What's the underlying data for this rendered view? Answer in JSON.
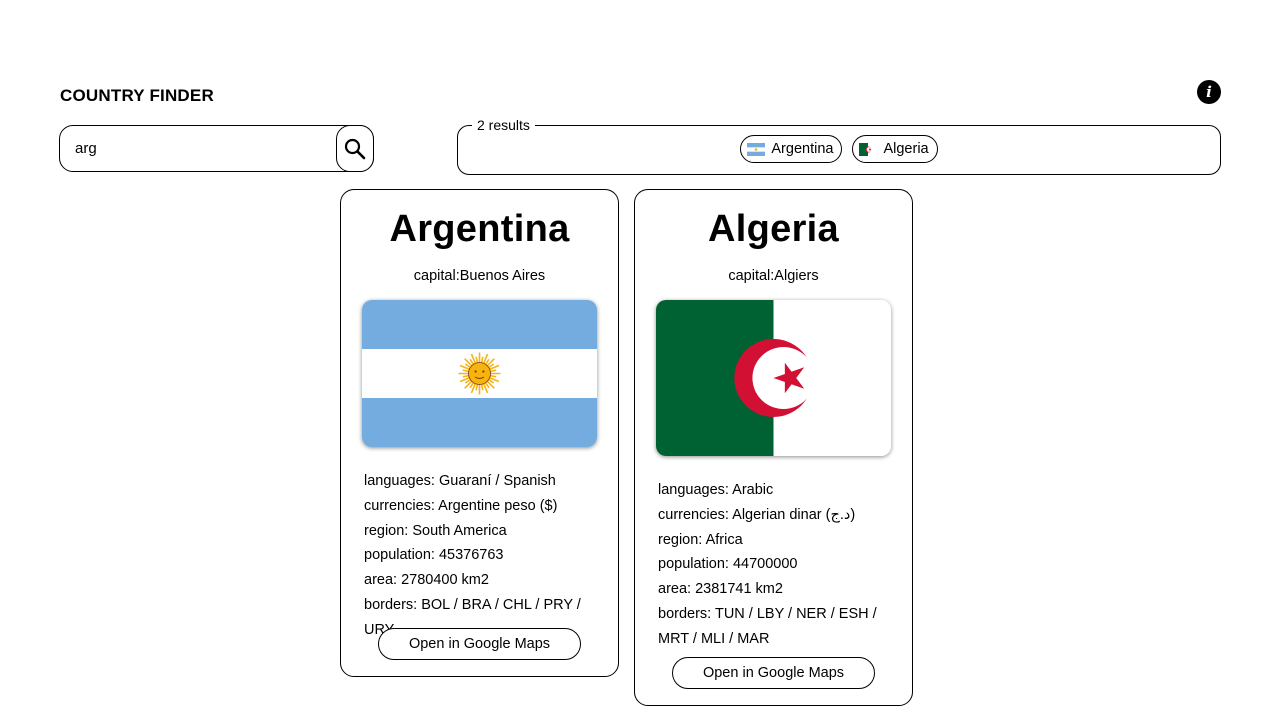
{
  "app": {
    "title": "COUNTRY FINDER",
    "info_icon": "info-icon"
  },
  "search": {
    "value": "arg",
    "placeholder": "",
    "icon": "search-icon"
  },
  "results": {
    "legend": "2 results",
    "chips": [
      {
        "label": "Argentina",
        "flag_icon": "argentina-flag-icon"
      },
      {
        "label": "Algeria",
        "flag_icon": "algeria-flag-icon"
      }
    ]
  },
  "cards": [
    {
      "name": "Argentina",
      "capital": "capital:Buenos Aires",
      "flag_icon": "argentina-flag-icon",
      "languages": "languages: Guaraní / Spanish",
      "currencies": "currencies: Argentine peso ($)",
      "region": "region: South America",
      "population": "population: 45376763",
      "area": "area: 2780400 km2",
      "borders": "borders: BOL / BRA / CHL / PRY / URY",
      "maps_label": "Open in Google Maps"
    },
    {
      "name": "Algeria",
      "capital": "capital:Algiers",
      "flag_icon": "algeria-flag-icon",
      "languages": "languages: Arabic",
      "currencies": "currencies: Algerian dinar (د.ج)",
      "region": "region: Africa",
      "population": "population: 44700000",
      "area": "area: 2381741 km2",
      "borders": "borders: TUN / LBY / NER / ESH / MRT / MLI / MAR",
      "maps_label": "Open in Google Maps"
    }
  ],
  "colors": {
    "argentina_blue": "#74acdf",
    "argentina_sun": "#f6b40e",
    "algeria_green": "#006233",
    "algeria_red": "#d21034"
  }
}
